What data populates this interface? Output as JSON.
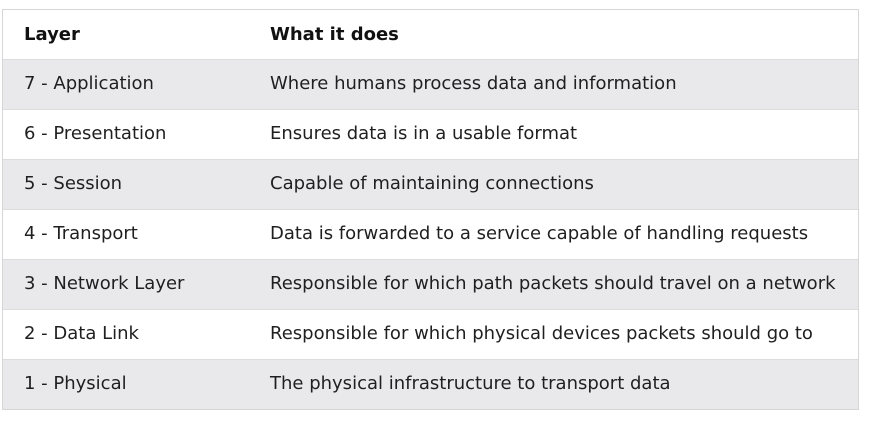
{
  "table": {
    "headers": [
      "Layer",
      "What it does"
    ],
    "rows": [
      {
        "layer": "7 - Application",
        "description": "Where humans process data and information"
      },
      {
        "layer": "6 - Presentation",
        "description": "Ensures data is in a usable format"
      },
      {
        "layer": "5 - Session",
        "description": "Capable of maintaining connections"
      },
      {
        "layer": "4 - Transport",
        "description": "Data is forwarded to a service capable of handling requests"
      },
      {
        "layer": "3 - Network Layer",
        "description": "Responsible for which path packets should travel on a network"
      },
      {
        "layer": "2 - Data Link",
        "description": "Responsible for which physical devices packets should go to"
      },
      {
        "layer": "1 - Physical",
        "description": "The physical infrastructure to transport data"
      }
    ]
  },
  "colors": {
    "shaded_row": "#e9e9eb",
    "plain_row": "#ffffff",
    "border": "#d6d6d6"
  }
}
